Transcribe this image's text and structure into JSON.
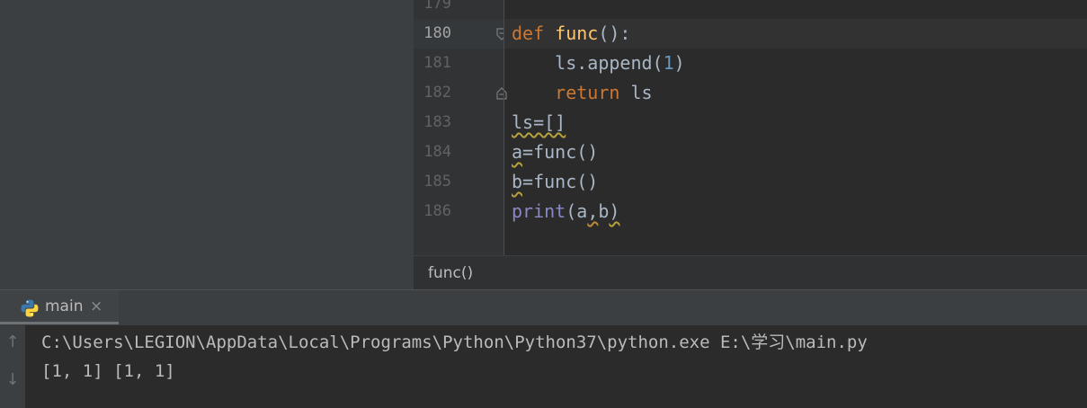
{
  "editor": {
    "line_numbers": [
      "179",
      "180",
      "181",
      "182",
      "183",
      "184",
      "185",
      "186"
    ],
    "current_line": "180",
    "code": {
      "l180": {
        "kw_def": "def",
        "fn_name": "func",
        "tail": "():"
      },
      "l181": {
        "indent": "    ",
        "obj": "ls.append(",
        "num": "1",
        "close": ")"
      },
      "l182": {
        "indent": "    ",
        "kw_return": "return",
        "rest": " ls"
      },
      "l183": {
        "text": "ls=[]"
      },
      "l184": {
        "var": "a",
        "rest": "=func()"
      },
      "l185": {
        "var": "b",
        "rest": "=func()"
      },
      "l186": {
        "builtin": "print",
        "open": "(",
        "a": "a",
        "comma": ",",
        "b": "b",
        "close": ")"
      }
    }
  },
  "breadcrumb": {
    "text": "func()"
  },
  "run_panel": {
    "tab_label": "main",
    "close_glyph": "×",
    "up_arrow": "↑",
    "down_arrow": "↓",
    "console_lines": [
      "C:\\Users\\LEGION\\AppData\\Local\\Programs\\Python\\Python37\\python.exe E:\\学习\\main.py",
      "[1, 1] [1, 1]"
    ]
  },
  "colors": {
    "background": "#2b2b2b",
    "keyword": "#cc7832",
    "function": "#ffc66d",
    "number": "#6897bb",
    "builtin": "#8888c6",
    "text": "#a9b7c6"
  }
}
